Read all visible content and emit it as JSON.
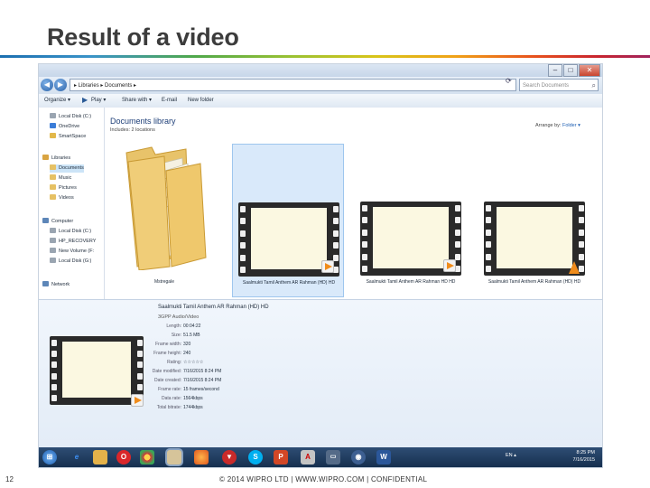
{
  "slide": {
    "title": "Result of a video",
    "page_number": "12",
    "footer": "© 2014 WIPRO LTD | WWW.WIPRO.COM | CONFIDENTIAL"
  },
  "explorer": {
    "address": "▸ Libraries ▸ Documents ▸",
    "search_placeholder": "Search Documents",
    "toolbar": {
      "organize": "Organize ▾",
      "open": "Play ▾",
      "share": "Share with ▾",
      "email": "E-mail",
      "new_folder": "New folder"
    },
    "nav": [
      {
        "label": "Local Disk (C:)",
        "icon": "drive-icon",
        "color": "#9aa5b1"
      },
      {
        "label": "OneDrive",
        "icon": "cloud-icon",
        "color": "#3b7dd8"
      },
      {
        "label": "SmartSpace",
        "icon": "folder-icon",
        "color": "#e2b84a"
      },
      {
        "label": "Libraries",
        "icon": "library-icon",
        "color": "#d9a441"
      },
      {
        "label": "Documents",
        "icon": "documents-icon",
        "color": "#e6c164"
      },
      {
        "label": "Music",
        "icon": "music-icon",
        "color": "#e6c164"
      },
      {
        "label": "Pictures",
        "icon": "pictures-icon",
        "color": "#e6c164"
      },
      {
        "label": "Videos",
        "icon": "videos-icon",
        "color": "#e6c164"
      },
      {
        "label": "Computer",
        "icon": "computer-icon",
        "color": "#5d86b8"
      },
      {
        "label": "Local Disk (C:)",
        "icon": "drive-icon",
        "color": "#9aa5b1"
      },
      {
        "label": "HP_RECOVERY",
        "icon": "drive-icon",
        "color": "#9aa5b1"
      },
      {
        "label": "New Volume (F:",
        "icon": "drive-icon",
        "color": "#9aa5b1"
      },
      {
        "label": "Local Disk (G:)",
        "icon": "drive-icon",
        "color": "#9aa5b1"
      },
      {
        "label": "Network",
        "icon": "network-icon",
        "color": "#5d86b8"
      }
    ],
    "library_title": "Documents library",
    "library_subtitle": "Includes: 2 locations",
    "arrange_label": "Arrange by:",
    "arrange_value": "Folder ▾",
    "tiles": [
      {
        "label": "Mstregale",
        "kind": "folder"
      },
      {
        "label": "Saalmukti Tamil Anthem AR Rahman (HD) HD",
        "kind": "video",
        "selected": true
      },
      {
        "label": "Saalmukti Tamil Anthem AR Rahman HD HD",
        "kind": "video"
      },
      {
        "label": "Saalmukti Tamil Anthem AR Rahman (HD) HD",
        "kind": "video"
      }
    ],
    "details": {
      "name": "Saalmukti Tamil Anthem AR Rahman (HD) HD",
      "type": "3GPP Audio/Video",
      "rows": [
        {
          "key": "Length:",
          "value": "00:04:22"
        },
        {
          "key": "Size:",
          "value": "51.5 MB"
        },
        {
          "key": "Frame width:",
          "value": "320"
        },
        {
          "key": "Frame height:",
          "value": "240"
        },
        {
          "key": "Rating:",
          "value": "☆☆☆☆☆"
        },
        {
          "key": "Date modified:",
          "value": "7/16/2015 8:24 PM"
        },
        {
          "key": "Date created:",
          "value": "7/16/2015 8:24 PM"
        },
        {
          "key": "Frame rate:",
          "value": "15 frames/second"
        },
        {
          "key": "Data rate:",
          "value": "1564kbps"
        },
        {
          "key": "Total bitrate:",
          "value": "1744kbps"
        }
      ]
    },
    "taskbar": {
      "time": "8:25 PM",
      "date": "7/16/2015",
      "system": "EN ▴"
    }
  }
}
